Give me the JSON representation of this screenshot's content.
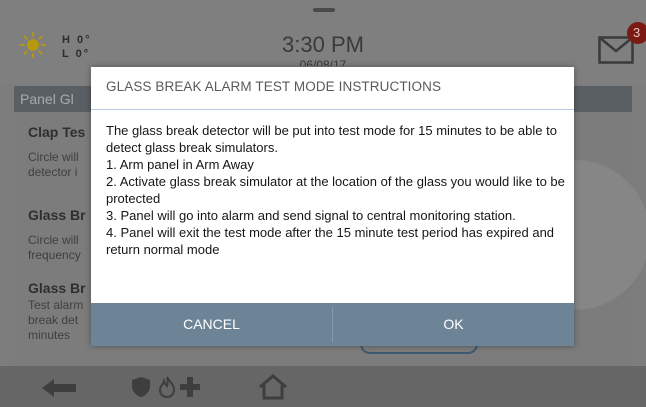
{
  "status": {
    "weather": {
      "high": "H 0°",
      "low": "L 0°"
    },
    "time": "3:30 PM",
    "date": "06/08/17",
    "message_count": "3"
  },
  "background_page": {
    "title": "Panel Gl",
    "items": [
      {
        "title": "Clap Tes",
        "text": [
          "Circle will",
          "detector i"
        ]
      },
      {
        "title": "Glass Br",
        "text": [
          "Circle will",
          "frequency"
        ]
      },
      {
        "title": "Glass Br",
        "text": [
          "Test alarm",
          "break det",
          "minutes"
        ]
      }
    ]
  },
  "dialog": {
    "title": "GLASS BREAK ALARM TEST MODE INSTRUCTIONS",
    "lines": [
      "The glass break detector will be put into test mode for 15 minutes to be able to detect glass break simulators.",
      "1. Arm panel in Arm Away",
      "2. Activate glass break simulator at the location of the glass you would like to be protected",
      "3. Panel will go into alarm and send signal to central monitoring station.",
      "4. Panel will exit the test mode after the 15 minute test period has expired and return normal mode"
    ],
    "cancel_label": "CANCEL",
    "ok_label": "OK"
  },
  "nav": {
    "icons": [
      "back-arrow-icon",
      "security-icon",
      "fire-icon",
      "medical-icon",
      "home-icon"
    ]
  },
  "colors": {
    "dialog_button_bar": "#6d8396",
    "badge": "#7a1a12",
    "sun": "#f2b705"
  }
}
